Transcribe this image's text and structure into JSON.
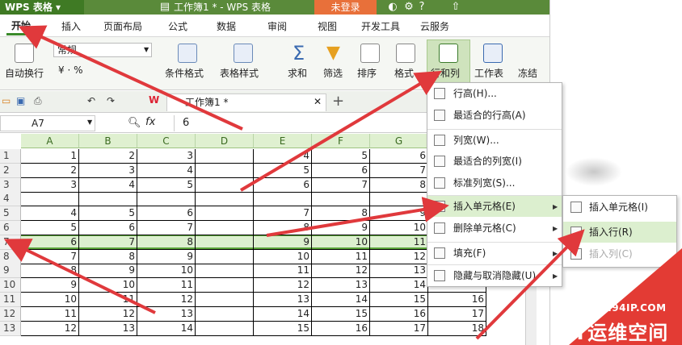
{
  "titlebar": {
    "app_menu": "WPS 表格",
    "doc_title": "工作簿1 * - WPS 表格",
    "login": "未登录"
  },
  "menubar": {
    "tabs": [
      "开始",
      "插入",
      "页面布局",
      "公式",
      "数据",
      "审阅",
      "视图",
      "开发工具",
      "云服务"
    ]
  },
  "ribbon": {
    "wrap": "自动换行",
    "format_value": "常规",
    "number_symbols": "¥ · %",
    "cond_format": "条件格式",
    "table_style": "表格样式",
    "sum": "求和",
    "filter": "筛选",
    "sort": "排序",
    "format": "格式",
    "row_col": "行和列",
    "worksheet": "工作表",
    "freeze": "冻结"
  },
  "doc_tab": {
    "name": "工作簿1 *"
  },
  "formula_bar": {
    "cell_ref": "A7",
    "fx": "fx",
    "value": "6"
  },
  "columns": [
    "A",
    "B",
    "C",
    "D",
    "E",
    "F",
    "G"
  ],
  "rows": [
    {
      "n": "1",
      "a": "1",
      "b": "2",
      "c": "3",
      "e": "4",
      "f": "5",
      "g": "6",
      "h": ""
    },
    {
      "n": "2",
      "a": "2",
      "b": "3",
      "c": "4",
      "e": "5",
      "f": "6",
      "g": "7",
      "h": ""
    },
    {
      "n": "3",
      "a": "3",
      "b": "4",
      "c": "5",
      "e": "6",
      "f": "7",
      "g": "8",
      "h": ""
    },
    {
      "n": "4",
      "a": "",
      "b": "",
      "c": "",
      "e": "",
      "f": "",
      "g": "",
      "h": ""
    },
    {
      "n": "5",
      "a": "4",
      "b": "5",
      "c": "6",
      "e": "7",
      "f": "8",
      "g": "9",
      "h": ""
    },
    {
      "n": "6",
      "a": "5",
      "b": "6",
      "c": "7",
      "e": "8",
      "f": "9",
      "g": "10",
      "h": ""
    },
    {
      "n": "7",
      "a": "6",
      "b": "7",
      "c": "8",
      "e": "9",
      "f": "10",
      "g": "11",
      "h": ""
    },
    {
      "n": "8",
      "a": "7",
      "b": "8",
      "c": "9",
      "e": "10",
      "f": "11",
      "g": "12",
      "h": ""
    },
    {
      "n": "9",
      "a": "8",
      "b": "9",
      "c": "10",
      "e": "11",
      "f": "12",
      "g": "13",
      "h": ""
    },
    {
      "n": "10",
      "a": "9",
      "b": "10",
      "c": "11",
      "e": "12",
      "f": "13",
      "g": "14",
      "h": ""
    },
    {
      "n": "11",
      "a": "10",
      "b": "11",
      "c": "12",
      "e": "13",
      "f": "14",
      "g": "15",
      "h": "16"
    },
    {
      "n": "12",
      "a": "11",
      "b": "12",
      "c": "13",
      "e": "14",
      "f": "15",
      "g": "16",
      "h": "17"
    },
    {
      "n": "13",
      "a": "12",
      "b": "13",
      "c": "14",
      "e": "15",
      "f": "16",
      "g": "17",
      "h": "18"
    }
  ],
  "context_menu": [
    {
      "label": "行高(H)...",
      "icon": "row-height-icon"
    },
    {
      "label": "最适合的行高(A)",
      "icon": "best-row-height-icon"
    },
    {
      "label": "列宽(W)...",
      "icon": "col-width-icon"
    },
    {
      "label": "最适合的列宽(I)",
      "icon": "best-col-width-icon"
    },
    {
      "label": "标准列宽(S)...",
      "icon": "std-col-width-icon"
    },
    {
      "label": "插入单元格(E)",
      "icon": "insert-cell-icon"
    },
    {
      "label": "删除单元格(C)",
      "icon": "delete-cell-icon"
    },
    {
      "label": "填充(F)",
      "icon": "fill-icon"
    },
    {
      "label": "隐藏与取消隐藏(U)",
      "icon": "hide-icon"
    }
  ],
  "submenu": [
    {
      "label": "插入单元格(I)",
      "icon": "insert-cell-icon"
    },
    {
      "label": "插入行(R)",
      "icon": "insert-row-icon"
    },
    {
      "label": "插入列(C)",
      "icon": "insert-col-icon"
    }
  ],
  "watermark": {
    "url": "WWW.94IP.COM",
    "name": "IT运维空间"
  },
  "colors": {
    "accent_green": "#5ba43a",
    "arrow_red": "#e0393c",
    "title_green": "#5a8a3a",
    "login_orange": "#e8703a"
  }
}
